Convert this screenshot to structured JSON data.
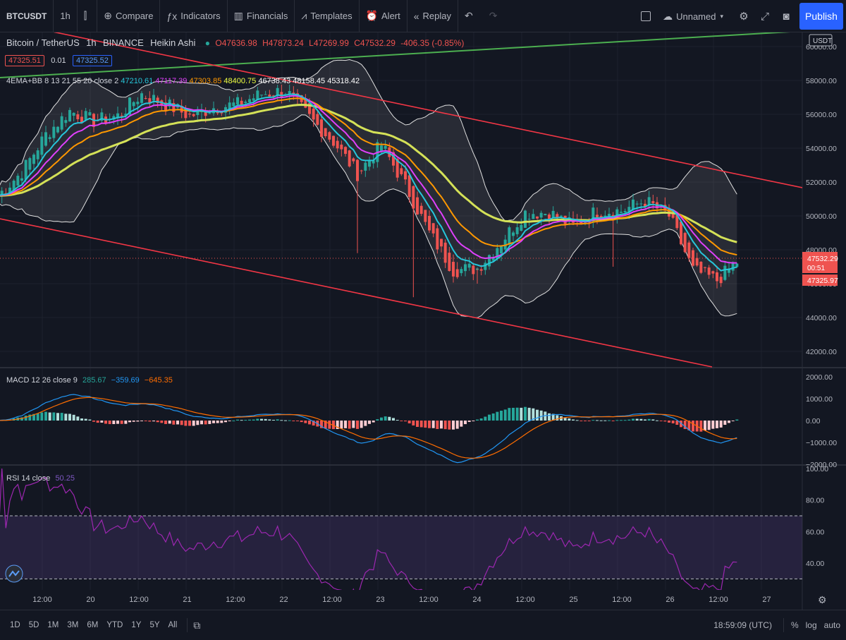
{
  "toolbar": {
    "symbol": "BTCUSDT",
    "interval": "1h",
    "compare": "Compare",
    "indicators": "Indicators",
    "financials": "Financials",
    "templates": "Templates",
    "alert": "Alert",
    "replay": "Replay",
    "layout_name": "Unnamed",
    "publish": "Publish"
  },
  "legend": {
    "pair": "Bitcoin / TetherUS",
    "interval": "1h",
    "exchange": "BINANCE",
    "style": "Heikin Ashi",
    "o": "O47636.98",
    "h": "H47873.24",
    "l": "L47269.99",
    "c": "C47532.29",
    "change": "-406.35 (-0.85%)",
    "bid": "47325.51",
    "spread": "0.01",
    "ask": "47325.52",
    "indicator_name": "4EMA+BB 8 13 21 55 20 close 2",
    "indicator_values": [
      {
        "v": "47210.61",
        "color": "#26c6da"
      },
      {
        "v": "47117.39",
        "color": "#e040fb"
      },
      {
        "v": "47303.85",
        "color": "#ff9800"
      },
      {
        "v": "48400.75",
        "color": "#eeff41"
      },
      {
        "v": "46738.43",
        "color": "#ffffff"
      },
      {
        "v": "48158.45",
        "color": "#ffffff"
      },
      {
        "v": "45318.42",
        "color": "#ffffff"
      }
    ]
  },
  "macd_legend": {
    "name": "MACD 12 26 close 9",
    "v1": "285.67",
    "v2": "−359.69",
    "v3": "−645.35"
  },
  "rsi_legend": {
    "name": "RSI 14 close",
    "value": "50.25"
  },
  "price_scale": {
    "currency": "USDT",
    "last_price": "47532.29",
    "countdown": "00:51",
    "second_price": "47325.97",
    "ticks": [
      "60000.00",
      "58000.00",
      "56000.00",
      "54000.00",
      "52000.00",
      "50000.00",
      "48000.00",
      "46000.00",
      "44000.00",
      "42000.00"
    ]
  },
  "macd_scale": {
    "ticks": [
      "2000.00",
      "1000.00",
      "0.00",
      "−1000.00",
      "−2000.00"
    ]
  },
  "rsi_scale": {
    "ticks": [
      "100.00",
      "80.00",
      "60.00",
      "40.00"
    ]
  },
  "time_axis": {
    "ticks": [
      "12:00",
      "20",
      "12:00",
      "21",
      "12:00",
      "22",
      "12:00",
      "23",
      "12:00",
      "24",
      "12:00",
      "25",
      "12:00",
      "26",
      "12:00",
      "27"
    ]
  },
  "bottombar": {
    "timeframes": [
      "1D",
      "5D",
      "1M",
      "3M",
      "6M",
      "YTD",
      "1Y",
      "5Y",
      "All"
    ],
    "clock": "18:59:09 (UTC)",
    "percent": "%",
    "log": "log",
    "auto": "auto"
  },
  "colors": {
    "bull": "#26a69a",
    "bear": "#ef5350",
    "ema8": "#26c6da",
    "ema13": "#e040fb",
    "ema21": "#ff9800",
    "ema55": "#d4e157",
    "trend_green": "#4caf50",
    "trend_red": "#f23645"
  },
  "chart_data": {
    "type": "candlestick",
    "title": "Bitcoin / TetherUS",
    "ylim": [
      41000,
      61000
    ],
    "grid": true,
    "close_path": [
      [
        "19 00:00",
        51200
      ],
      [
        "19 06:00",
        52600
      ],
      [
        "19 12:00",
        54800
      ],
      [
        "19 18:00",
        56200
      ],
      [
        "20 00:00",
        55600
      ],
      [
        "20 06:00",
        55900
      ],
      [
        "20 12:00",
        57200
      ],
      [
        "20 18:00",
        56600
      ],
      [
        "21 00:00",
        55900
      ],
      [
        "21 06:00",
        56400
      ],
      [
        "21 12:00",
        56600
      ],
      [
        "21 18:00",
        57200
      ],
      [
        "22 00:00",
        57400
      ],
      [
        "22 06:00",
        55800
      ],
      [
        "22 12:00",
        54400
      ],
      [
        "22 18:00",
        52500
      ],
      [
        "23 00:00",
        54200
      ],
      [
        "23 06:00",
        51800
      ],
      [
        "23 12:00",
        49000
      ],
      [
        "23 18:00",
        46800
      ],
      [
        "24 00:00",
        46900
      ],
      [
        "24 06:00",
        48500
      ],
      [
        "24 12:00",
        50200
      ],
      [
        "24 18:00",
        50200
      ],
      [
        "25 00:00",
        49400
      ],
      [
        "25 06:00",
        50300
      ],
      [
        "25 12:00",
        50300
      ],
      [
        "25 18:00",
        50900
      ],
      [
        "26 00:00",
        50000
      ],
      [
        "26 06:00",
        46800
      ],
      [
        "26 12:00",
        46200
      ],
      [
        "26 18:00",
        47500
      ]
    ],
    "macd_range": [
      -2000,
      2000
    ],
    "rsi_range": [
      20,
      100
    ],
    "rsi_bands": [
      30,
      70
    ]
  }
}
